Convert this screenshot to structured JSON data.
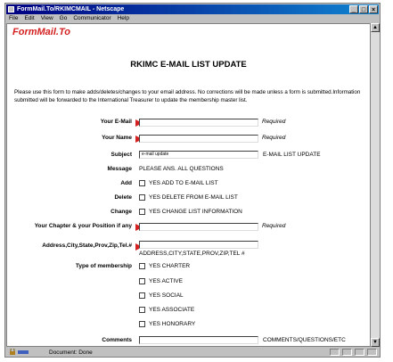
{
  "window": {
    "title": "FormMail.To/RKIMCMAIL - Netscape",
    "buttons": [
      "_",
      "□",
      "×"
    ]
  },
  "menu": [
    "File",
    "Edit",
    "View",
    "Go",
    "Communicator",
    "Help"
  ],
  "logo": "FormMail.To",
  "heading": "RKIMC E-MAIL LIST UPDATE",
  "intro": "Please use this form to make adds/deletes/changes to your email address. No corrections will be made unless a form is submitted.Information submitted will be forwarded to the International Treasurer to update the membership master list.",
  "form": {
    "email_label": "Your E-Mail",
    "name_label": "Your Name",
    "required": "Required",
    "subject_label": "Subject",
    "subject_value": "e-mail update",
    "subject_note": "E-MAIL LIST UPDATE",
    "message_label": "Message",
    "message_text": "PLEASE ANS. ALL QUESTIONS",
    "add_label": "Add",
    "add_option": "YES ADD TO E-MAIL LIST",
    "delete_label": "Delete",
    "delete_option": "YES DELETE FROM E-MAIL LIST",
    "change_label": "Change",
    "change_option": "YES CHANGE LIST INFORMATION",
    "chapter_label": "Your Chapter & your Position if any",
    "address_label": "Address,City,State,Prov,Zip,Tel.#",
    "address_note": "ADDRESS,CITY,STATE,PROV,ZIP,TEL #",
    "membership_label": "Type of membership",
    "membership_options": [
      "YES CHARTER",
      "YES ACTIVE",
      "YES SOCIAL",
      "YES ASSOCIATE",
      "YES HONORARY"
    ],
    "comments_label": "Comments",
    "comments_note": "COMMENTS/QUESTIONS/ETC"
  },
  "status": {
    "text": "Document: Done"
  }
}
